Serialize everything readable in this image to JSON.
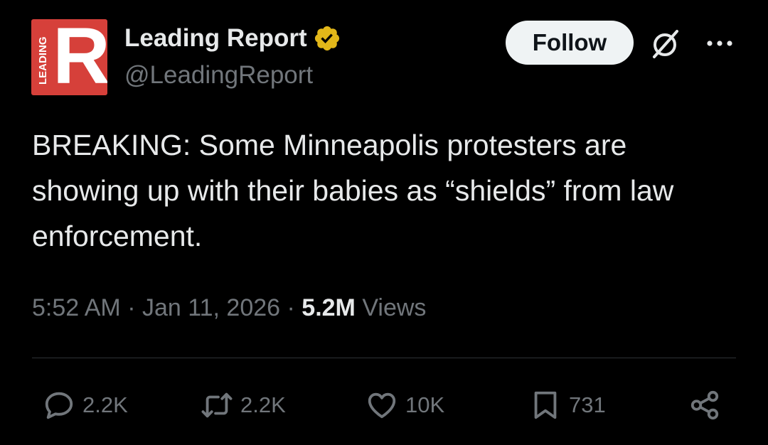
{
  "author": {
    "display_name": "Leading Report",
    "handle": "@LeadingReport",
    "avatar_letter": "R",
    "avatar_vertical_text": "LEADING",
    "verified_color": "#e2b719"
  },
  "follow_label": "Follow",
  "icons": {
    "grok": "grok-icon",
    "more": "more-icon",
    "reply": "reply-icon",
    "repost": "repost-icon",
    "like": "like-icon",
    "bookmark": "bookmark-icon",
    "share": "share-icon"
  },
  "tweet": {
    "text": "BREAKING: Some Minneapolis protesters are showing up with their babies as “shields” from law enforcement."
  },
  "meta": {
    "time": "5:52 AM",
    "separator": " · ",
    "date": "Jan 11, 2026",
    "views_count": "5.2M",
    "views_label": "Views"
  },
  "actions": {
    "replies": "2.2K",
    "reposts": "2.2K",
    "likes": "10K",
    "bookmarks": "731"
  },
  "colors": {
    "background": "#000000",
    "text_primary": "#e7e9ea",
    "text_secondary": "#71767b",
    "avatar_red": "#d6403a",
    "follow_bg": "#eff3f4"
  }
}
